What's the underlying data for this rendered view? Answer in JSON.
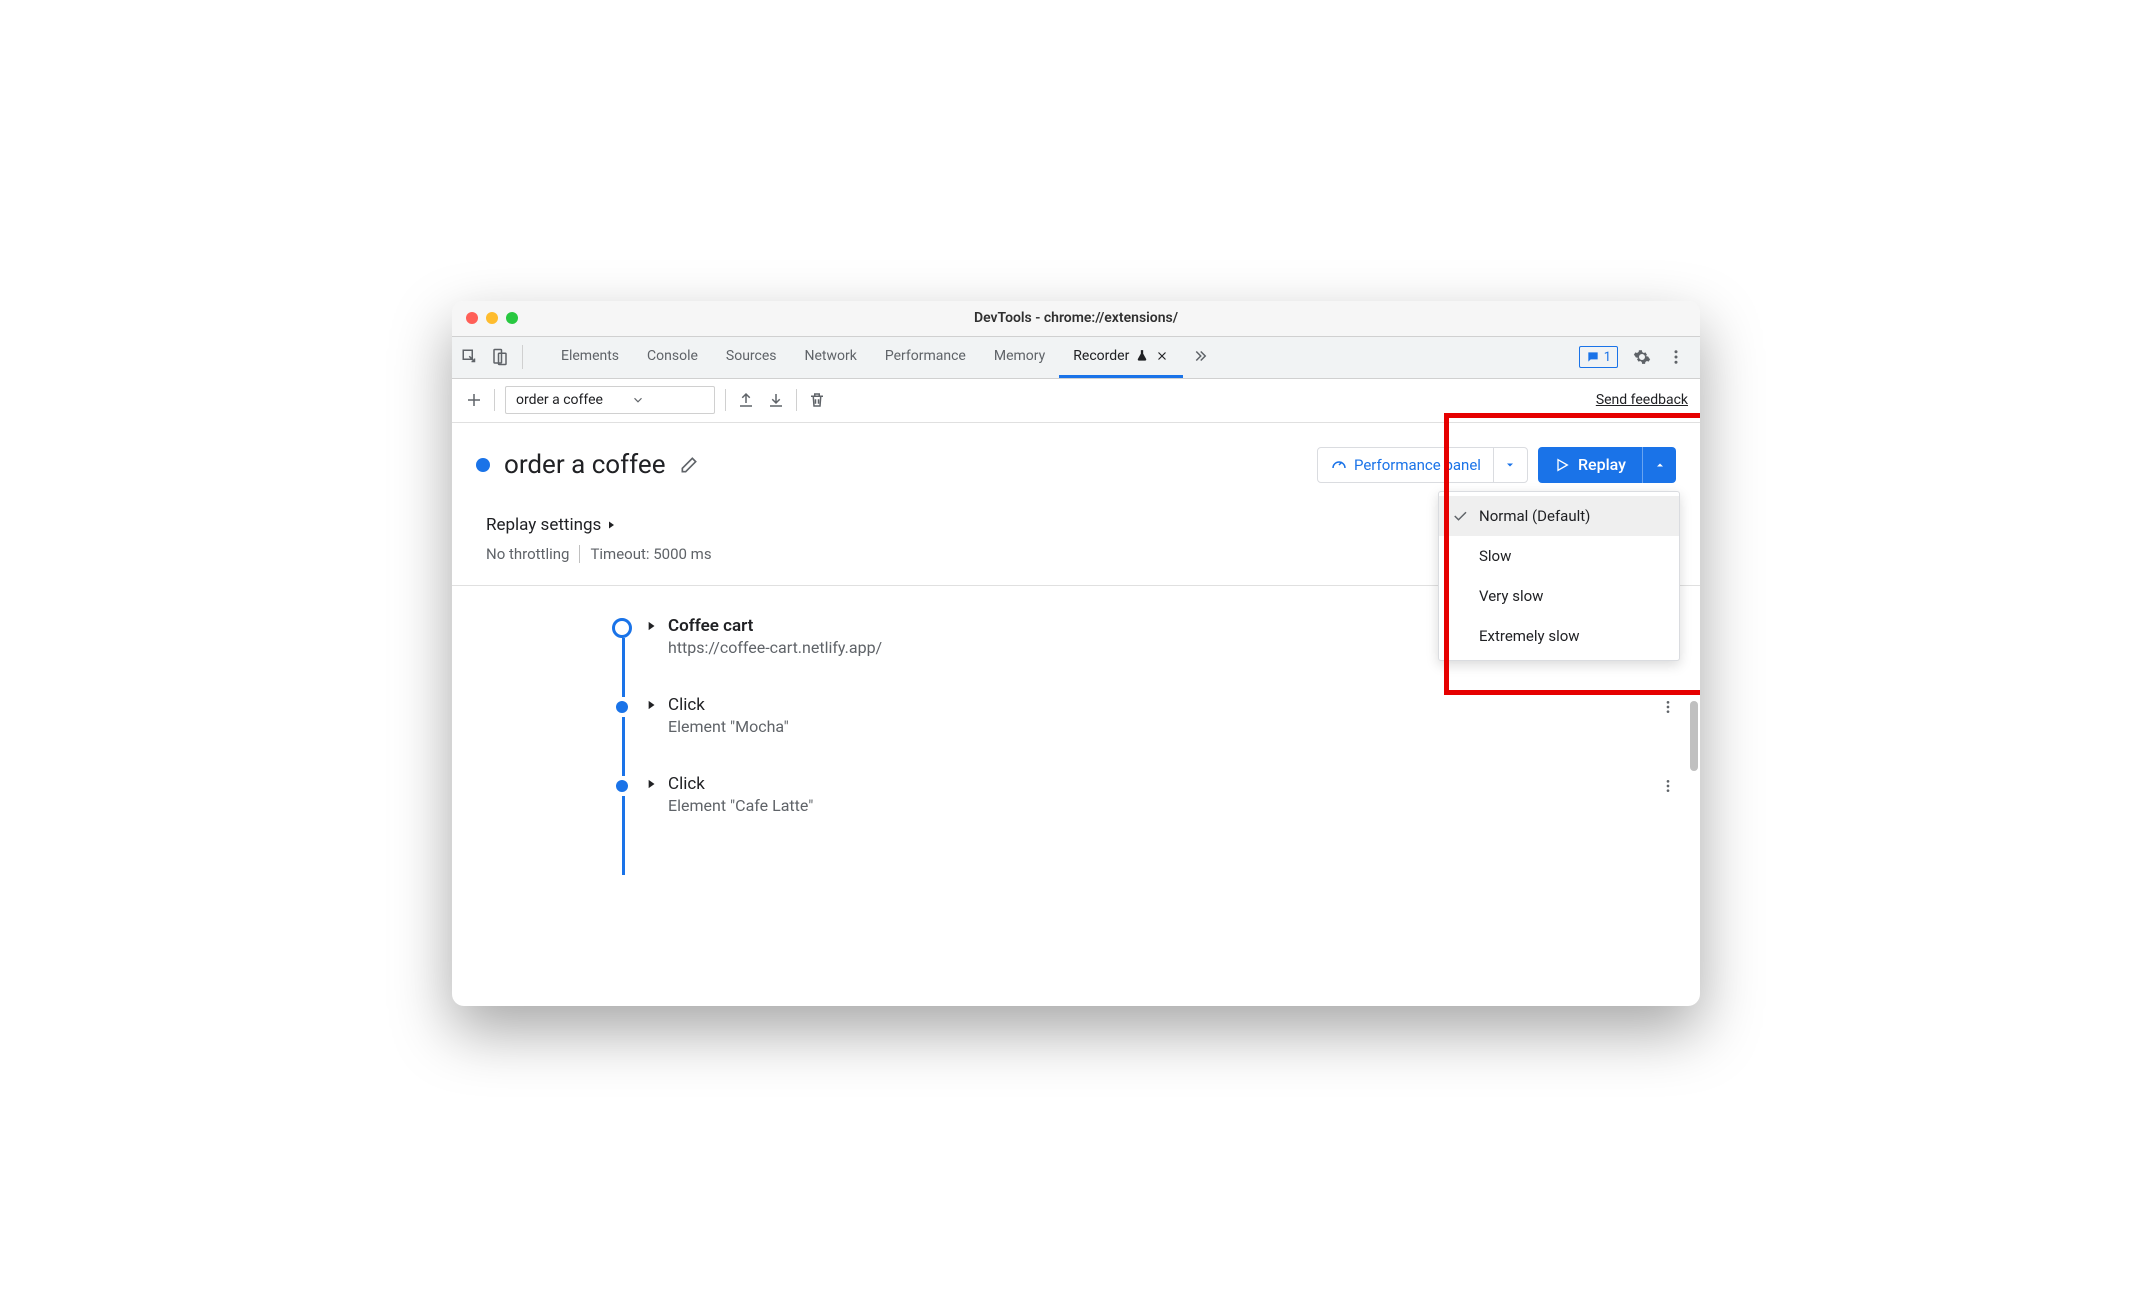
{
  "window": {
    "title": "DevTools - chrome://extensions/"
  },
  "tabs": {
    "items": [
      "Elements",
      "Console",
      "Sources",
      "Network",
      "Performance",
      "Memory",
      "Recorder"
    ],
    "activeIndex": 6
  },
  "issues": {
    "count": "1"
  },
  "toolbar": {
    "recordingName": "order a coffee",
    "feedback": "Send feedback"
  },
  "recording": {
    "title": "order a coffee",
    "perfPanel": "Performance panel",
    "replay": "Replay"
  },
  "replayOptions": {
    "items": [
      "Normal (Default)",
      "Slow",
      "Very slow",
      "Extremely slow"
    ],
    "selectedIndex": 0
  },
  "settings": {
    "heading": "Replay settings",
    "throttling": "No throttling",
    "timeout": "Timeout: 5000 ms"
  },
  "steps": [
    {
      "title": "Coffee cart",
      "sub": "https://coffee-cart.netlify.app/",
      "bold": true,
      "ring": true
    },
    {
      "title": "Click",
      "sub": "Element \"Mocha\"",
      "bold": false,
      "ring": false
    },
    {
      "title": "Click",
      "sub": "Element \"Cafe Latte\"",
      "bold": false,
      "ring": false
    }
  ]
}
